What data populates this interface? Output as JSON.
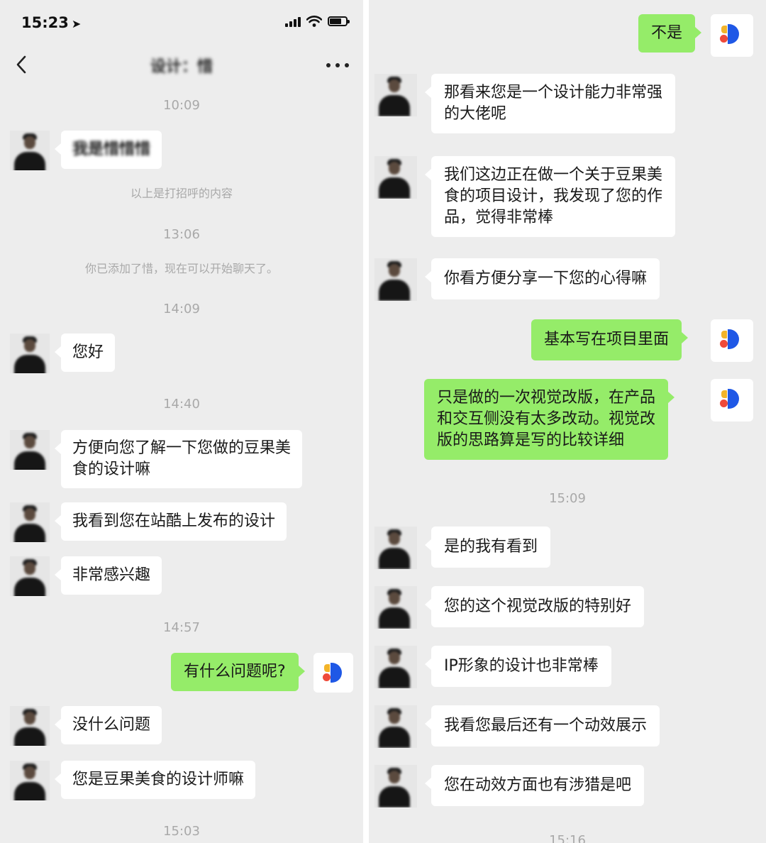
{
  "left": {
    "status": {
      "time": "15:23"
    },
    "header": {
      "title": "设计：惜"
    },
    "timestamps": [
      "10:09",
      "13:06",
      "14:09",
      "14:40",
      "14:57",
      "15:03"
    ],
    "system_notes": [
      "以上是打招呼的内容",
      "你已添加了惜，现在可以开始聊天了。"
    ],
    "messages": [
      {
        "text": "我是惜惜惜"
      },
      {
        "text": "您好"
      },
      {
        "text": "方便向您了解一下您做的豆果美",
        "text2": "食的设计嘛"
      },
      {
        "text": "我看到您在站酷上发布的设计"
      },
      {
        "text": "非常感兴趣"
      },
      {
        "text": "有什么问题呢?"
      },
      {
        "text": "没什么问题"
      },
      {
        "text": "您是豆果美食的设计师嘛"
      }
    ]
  },
  "right": {
    "timestamps": [
      "15:09",
      "15:16"
    ],
    "messages": [
      {
        "text": "不是"
      },
      {
        "text": "那看来您是一个设计能力非常强",
        "text2": "的大佬呢"
      },
      {
        "text": "我们这边正在做一个关于豆果美",
        "text2": "食的项目设计，我发现了您的作",
        "text3": "品，觉得非常棒"
      },
      {
        "text": "你看方便分享一下您的心得嘛"
      },
      {
        "text": "基本写在项目里面"
      },
      {
        "text": "只是做的一次视觉改版，在产品",
        "text2": "和交互侧没有太多改动。视觉改",
        "text3": "版的思路算是写的比较详细"
      },
      {
        "text": "是的我有看到"
      },
      {
        "text": "您的这个视觉改版的特别好"
      },
      {
        "text": "IP形象的设计也非常棒"
      },
      {
        "text": "我看您最后还有一个动效展示"
      },
      {
        "text": "您在动效方面也有涉猎是吧"
      }
    ]
  },
  "colors": {
    "chat_bg": "#ededed",
    "bubble_in": "#ffffff",
    "bubble_out": "#95ec69",
    "meta_text": "#a9a9a9"
  },
  "icons": {
    "back": "chevron-left-icon",
    "more": "more-dots-icon",
    "location": "location-arrow-icon",
    "signal": "signal-icon",
    "wifi": "wifi-icon",
    "battery": "battery-icon"
  }
}
